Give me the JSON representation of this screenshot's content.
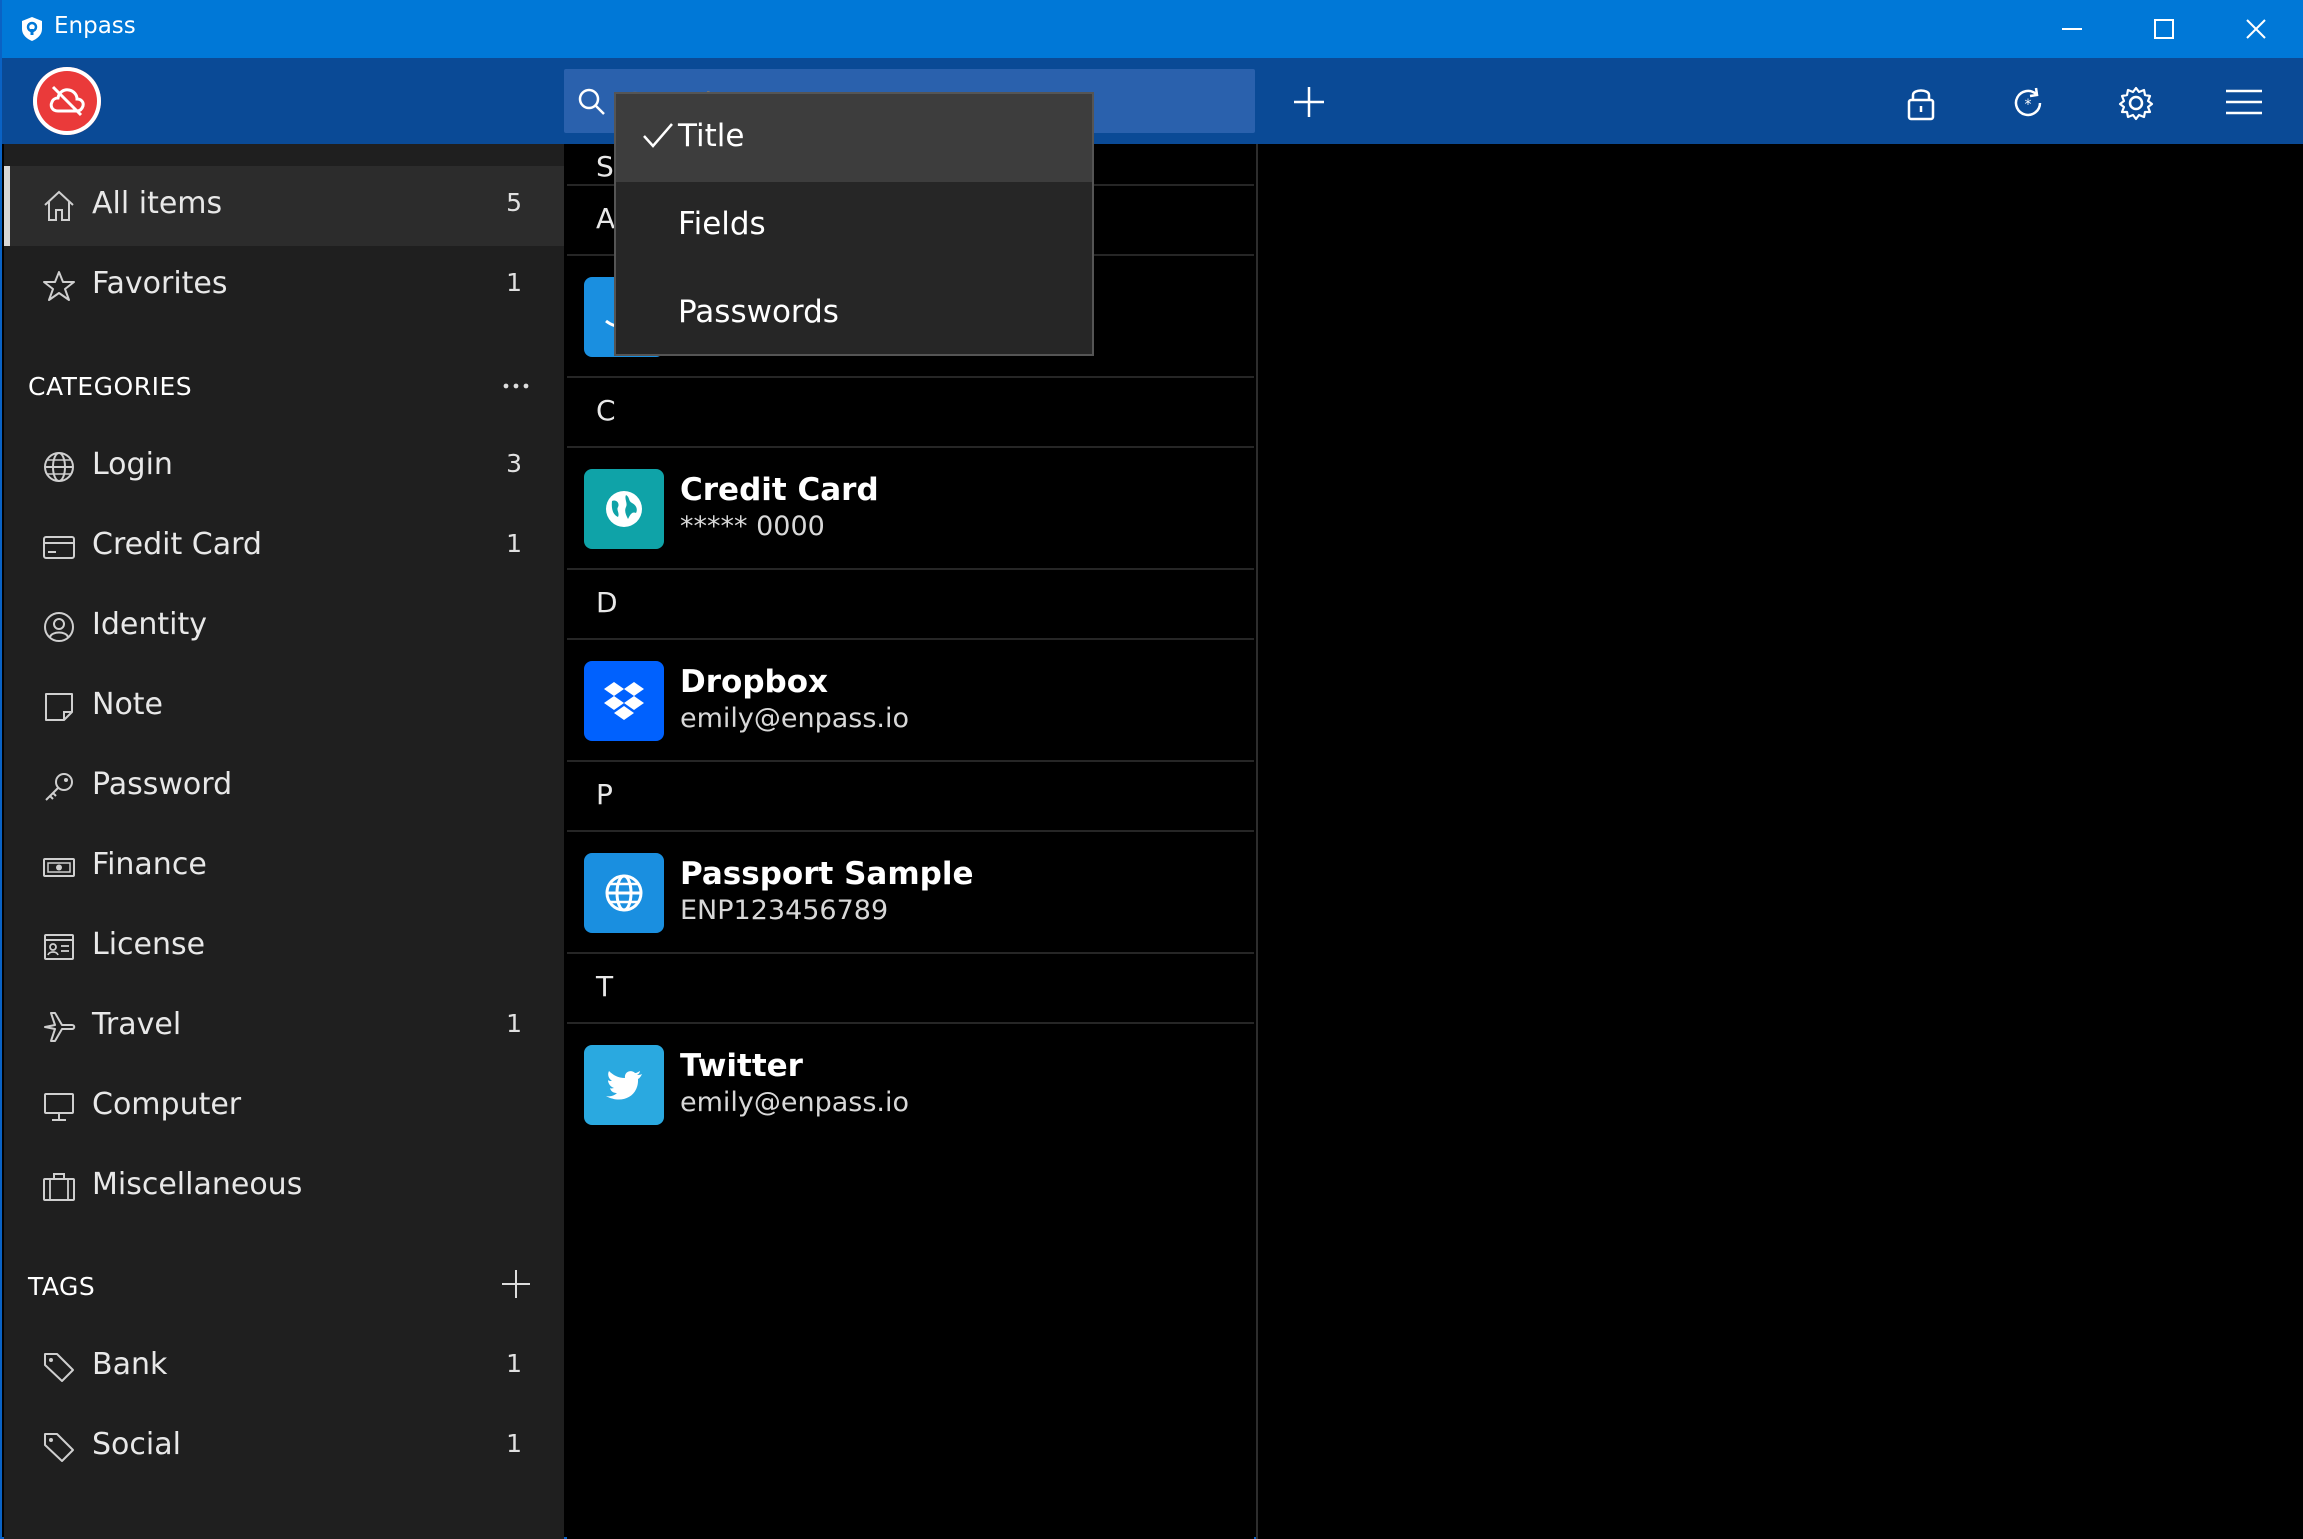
{
  "window": {
    "title": "Enpass"
  },
  "search": {
    "placeholder": "Search"
  },
  "sidebar": {
    "all_items": {
      "label": "All items",
      "count": "5"
    },
    "favorites": {
      "label": "Favorites",
      "count": "1"
    },
    "categories_header": "CATEGORIES",
    "categories": [
      {
        "label": "Login",
        "count": "3",
        "icon": "globe-icon"
      },
      {
        "label": "Credit Card",
        "count": "1",
        "icon": "credit-card-icon"
      },
      {
        "label": "Identity",
        "count": "",
        "icon": "identity-icon"
      },
      {
        "label": "Note",
        "count": "",
        "icon": "note-icon"
      },
      {
        "label": "Password",
        "count": "",
        "icon": "key-icon"
      },
      {
        "label": "Finance",
        "count": "",
        "icon": "money-icon"
      },
      {
        "label": "License",
        "count": "",
        "icon": "license-icon"
      },
      {
        "label": "Travel",
        "count": "1",
        "icon": "airplane-icon"
      },
      {
        "label": "Computer",
        "count": "",
        "icon": "computer-icon"
      },
      {
        "label": "Miscellaneous",
        "count": "",
        "icon": "briefcase-icon"
      }
    ],
    "tags_header": "TAGS",
    "tags": [
      {
        "label": "Bank",
        "count": "1"
      },
      {
        "label": "Social",
        "count": "1"
      }
    ]
  },
  "list": {
    "sort_header_partial": "S",
    "groups": [
      "A",
      "C",
      "D",
      "P",
      "T"
    ],
    "items": [
      {
        "title": "Credit Card",
        "subtitle": "***** 0000",
        "icon": "globe-icon",
        "color": "#0fa3a8"
      },
      {
        "title": "Dropbox",
        "subtitle": "emily@enpass.io",
        "icon": "dropbox-icon",
        "color": "#0061fe"
      },
      {
        "title": "Passport Sample",
        "subtitle": "ENP123456789",
        "icon": "globe-icon",
        "color": "#1a8fe0"
      },
      {
        "title": "Twitter",
        "subtitle": "emily@enpass.io",
        "icon": "twitter-icon",
        "color": "#2aa9e0"
      }
    ]
  },
  "search_scope_menu": {
    "options": [
      "Title",
      "Fields",
      "Passwords"
    ],
    "selected": "Title"
  },
  "colors": {
    "titlebar": "#0078d7",
    "toolbar": "#0a4a96",
    "logo": "#ea3a3a",
    "sidebar": "#1f1f1f"
  }
}
